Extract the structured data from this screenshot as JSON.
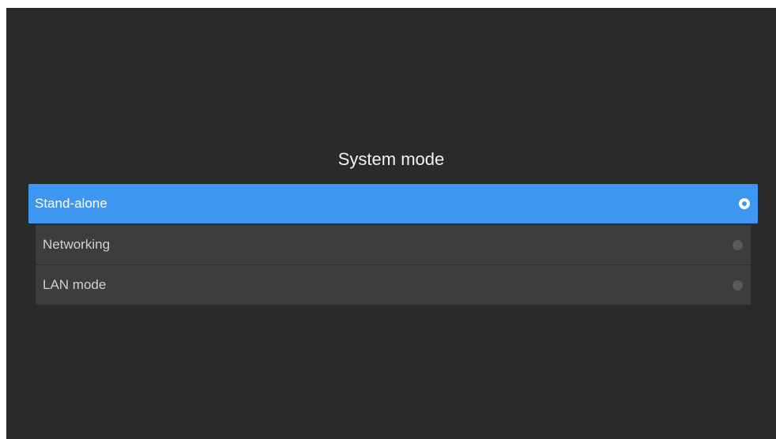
{
  "dialog": {
    "title": "System mode",
    "options": [
      {
        "label": "Stand-alone",
        "selected": true
      },
      {
        "label": "Networking",
        "selected": false
      },
      {
        "label": "LAN mode",
        "selected": false
      }
    ]
  },
  "colors": {
    "background": "#2a2a2a",
    "accent": "#3d97f0",
    "item_background": "#3d3d3d",
    "text_primary": "#f2f2f2",
    "text_secondary": "#d0d0d0"
  },
  "icons": {
    "selected": "radio-selected-icon",
    "unselected": "radio-unselected-icon"
  }
}
